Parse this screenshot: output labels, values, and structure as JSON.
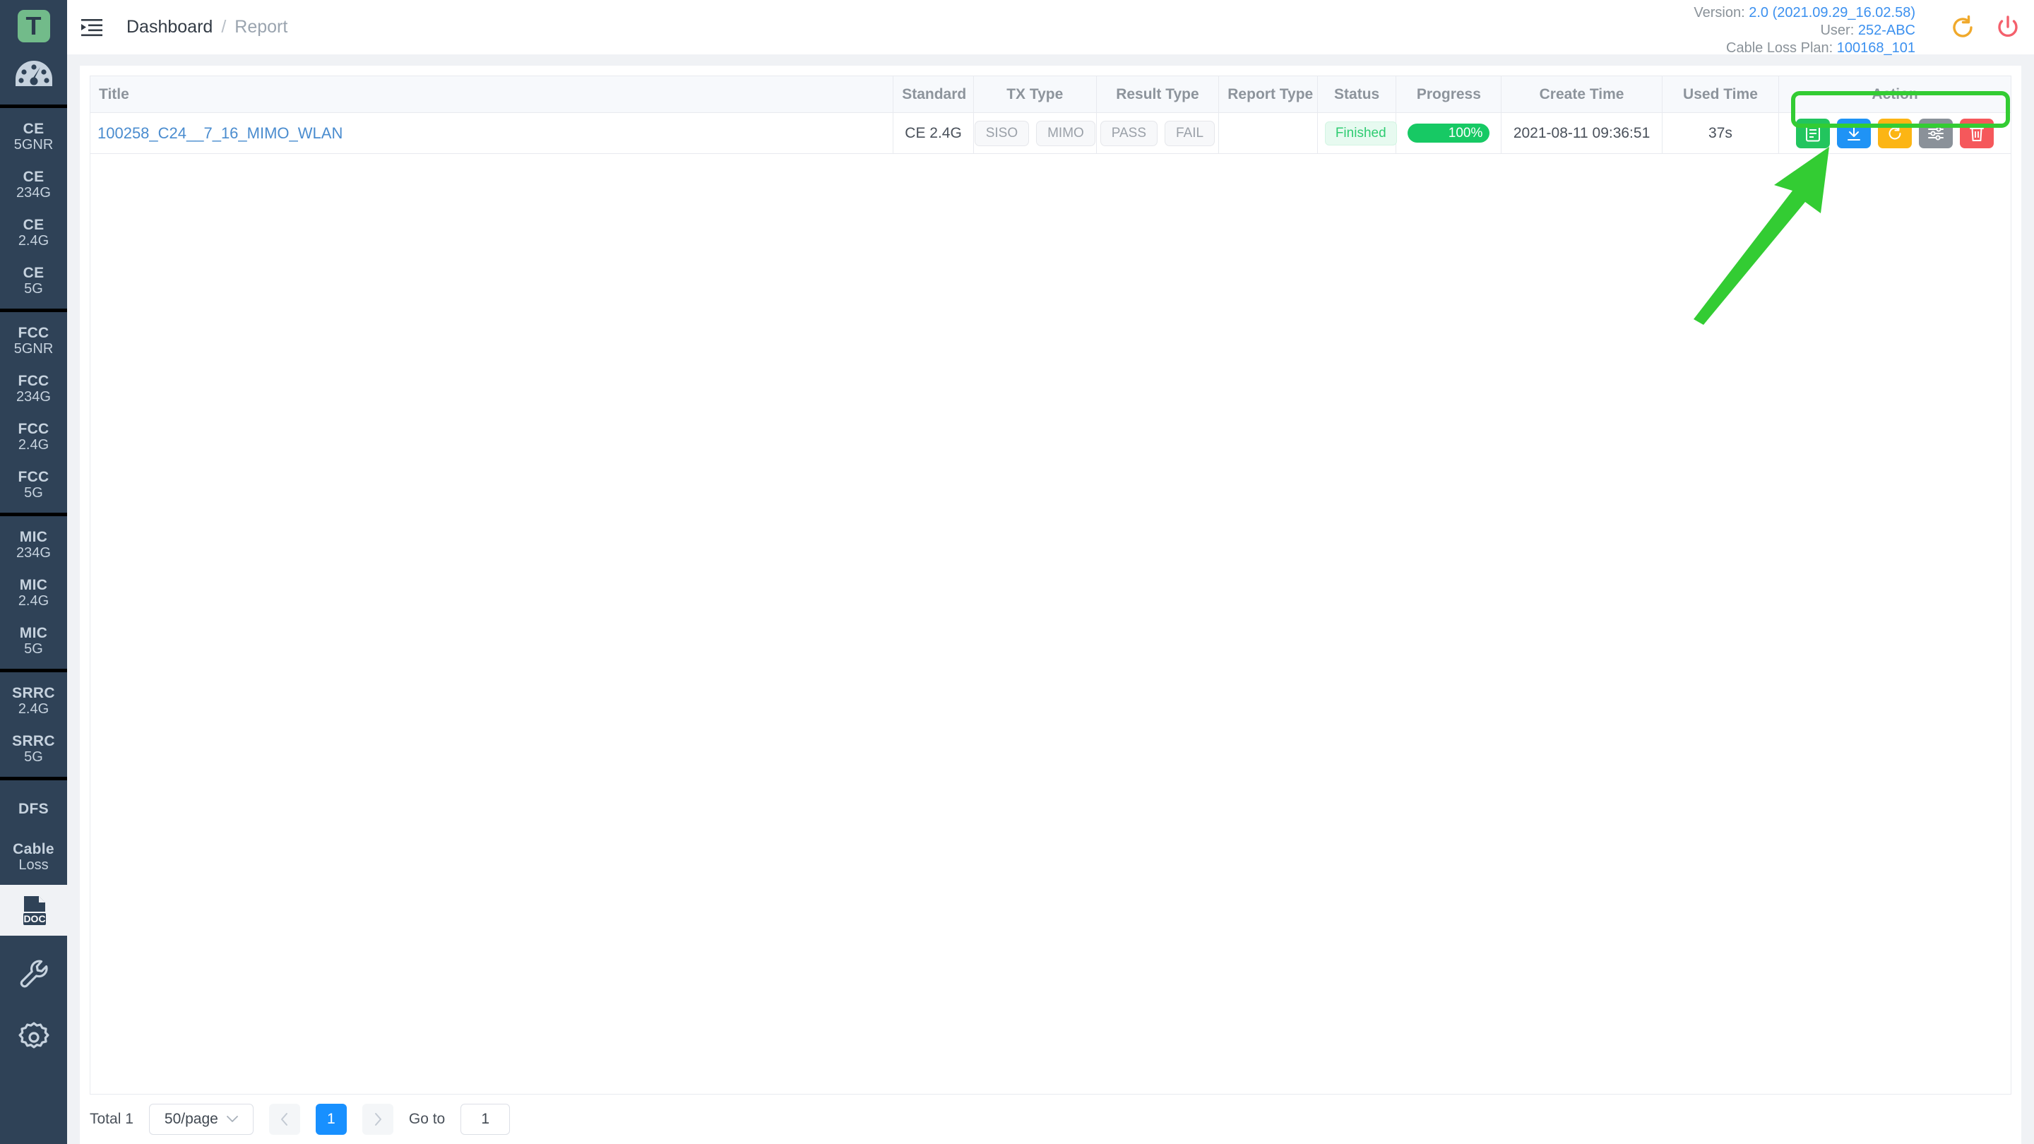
{
  "sidebar": {
    "logo_text": "T",
    "logo_icon": "logo-t-icon",
    "dashboard_icon": "gauge-icon",
    "groups": [
      {
        "items": [
          {
            "l1": "CE",
            "l2": "5GNR",
            "name": "sidebar-item-ce-5gnr"
          },
          {
            "l1": "CE",
            "l2": "234G",
            "name": "sidebar-item-ce-234g"
          },
          {
            "l1": "CE",
            "l2": "2.4G",
            "name": "sidebar-item-ce-24g"
          },
          {
            "l1": "CE",
            "l2": "5G",
            "name": "sidebar-item-ce-5g"
          }
        ]
      },
      {
        "items": [
          {
            "l1": "FCC",
            "l2": "5GNR",
            "name": "sidebar-item-fcc-5gnr"
          },
          {
            "l1": "FCC",
            "l2": "234G",
            "name": "sidebar-item-fcc-234g"
          },
          {
            "l1": "FCC",
            "l2": "2.4G",
            "name": "sidebar-item-fcc-24g"
          },
          {
            "l1": "FCC",
            "l2": "5G",
            "name": "sidebar-item-fcc-5g"
          }
        ]
      },
      {
        "items": [
          {
            "l1": "MIC",
            "l2": "234G",
            "name": "sidebar-item-mic-234g"
          },
          {
            "l1": "MIC",
            "l2": "2.4G",
            "name": "sidebar-item-mic-24g"
          },
          {
            "l1": "MIC",
            "l2": "5G",
            "name": "sidebar-item-mic-5g"
          }
        ]
      },
      {
        "items": [
          {
            "l1": "SRRC",
            "l2": "2.4G",
            "name": "sidebar-item-srrc-24g"
          },
          {
            "l1": "SRRC",
            "l2": "5G",
            "name": "sidebar-item-srrc-5g"
          }
        ]
      },
      {
        "items": [
          {
            "l1": "DFS",
            "l2": "",
            "name": "sidebar-item-dfs"
          },
          {
            "l1": "Cable",
            "l2": "Loss",
            "name": "sidebar-item-cable-loss"
          }
        ]
      }
    ],
    "doc_item": {
      "label": "DOC",
      "icon": "doc-file-icon",
      "name": "sidebar-item-doc",
      "selected": true
    },
    "tools": [
      {
        "icon": "wrench-icon",
        "name": "sidebar-item-tools"
      },
      {
        "icon": "gear-icon",
        "name": "sidebar-item-settings"
      }
    ]
  },
  "header": {
    "menu_icon": "hamburger-menu-icon",
    "breadcrumb": {
      "root": "Dashboard",
      "separator": "/",
      "current": "Report"
    },
    "info": [
      {
        "label": "Version:",
        "value": "2.0 (2021.09.29_16.02.58)"
      },
      {
        "label": "User:",
        "value": "252-ABC"
      },
      {
        "label": "Cable Loss Plan:",
        "value": "100168_101"
      }
    ],
    "refresh_icon": "refresh-icon",
    "power_icon": "power-icon",
    "refresh_color": "#f0a92b",
    "power_color": "#f4606c"
  },
  "table": {
    "columns": [
      {
        "key": "title",
        "label": "Title"
      },
      {
        "key": "standard",
        "label": "Standard"
      },
      {
        "key": "tx_type",
        "label": "TX Type"
      },
      {
        "key": "result_type",
        "label": "Result Type"
      },
      {
        "key": "report_type",
        "label": "Report Type"
      },
      {
        "key": "status",
        "label": "Status"
      },
      {
        "key": "progress",
        "label": "Progress"
      },
      {
        "key": "create_time",
        "label": "Create Time"
      },
      {
        "key": "used_time",
        "label": "Used Time"
      },
      {
        "key": "action",
        "label": "Action"
      }
    ],
    "rows": [
      {
        "title": "100258_C24__7_16_MIMO_WLAN",
        "standard": "CE 2.4G",
        "tx_type": [
          "SISO",
          "MIMO"
        ],
        "result_type": [
          "PASS",
          "FAIL"
        ],
        "report_type": "",
        "status": "Finished",
        "progress": "100%",
        "progress_value": 100,
        "create_time": "2021-08-11 09:36:51",
        "used_time": "37s",
        "actions": [
          {
            "name": "view-report-button",
            "icon": "document-icon",
            "color": "#22c55e"
          },
          {
            "name": "download-button",
            "icon": "download-icon",
            "color": "#1f93f5"
          },
          {
            "name": "rerun-button",
            "icon": "refresh-icon",
            "color": "#fcb514"
          },
          {
            "name": "configure-button",
            "icon": "sliders-icon",
            "color": "#8a9199"
          },
          {
            "name": "delete-button",
            "icon": "trash-icon",
            "color": "#f5585b"
          }
        ]
      }
    ]
  },
  "pagination": {
    "total_label": "Total 1",
    "page_size": "50/page",
    "prev_icon": "chevron-left-icon",
    "next_icon": "chevron-right-icon",
    "current_page": "1",
    "goto_label": "Go to",
    "goto_value": "1"
  },
  "annotation": {
    "highlight_color": "#33cc33",
    "arrow_name": "annotation-arrow",
    "box_name": "annotation-highlight-box"
  }
}
